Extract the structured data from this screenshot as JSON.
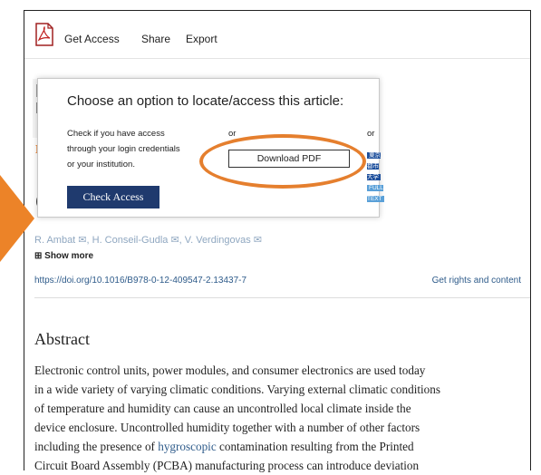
{
  "toolbar": {
    "get_access": "Get Access",
    "share": "Share",
    "export": "Export"
  },
  "modal": {
    "title": "Choose an option to locate/access this article:",
    "col1_line1": "Check if you have access",
    "col1_line2": "through your login credentials",
    "col1_line3": "or your institution.",
    "or1": "or",
    "or2": "or",
    "check_access": "Check Access",
    "download_pdf": "Download PDF",
    "badge_left": "東京都市大学",
    "badge_right": "FULL TEXT"
  },
  "background": {
    "e_fragment": "E:",
    "c_fragment": "C",
    "authors": "R. Ambat ✉, H. Conseil-Gudla ✉, V. Verdingovas ✉",
    "show_more": "⊞ Show more",
    "doi": "https://doi.org/10.1016/B978-0-12-409547-2.13437-7",
    "rights": "Get rights and content"
  },
  "abstract": {
    "title": "Abstract",
    "line1": "Electronic control units, power modules, and consumer electronics are used today",
    "line2": "in a wide variety of varying climatic conditions. Varying external climatic conditions",
    "line3": "of temperature and humidity can cause an uncontrolled local climate inside the",
    "line4": "device enclosure. Uncontrolled humidity together with a number of other factors",
    "line5a": "including the presence of ",
    "line5_link": "hygroscopic",
    "line5b": " contamination resulting from the Printed",
    "line6": "Circuit Board Assembly (PCBA) manufacturing process can introduce deviation"
  },
  "colors": {
    "accent_orange": "#e57f2e",
    "button_navy": "#1f3a6e",
    "link_blue": "#2e5b8a"
  }
}
